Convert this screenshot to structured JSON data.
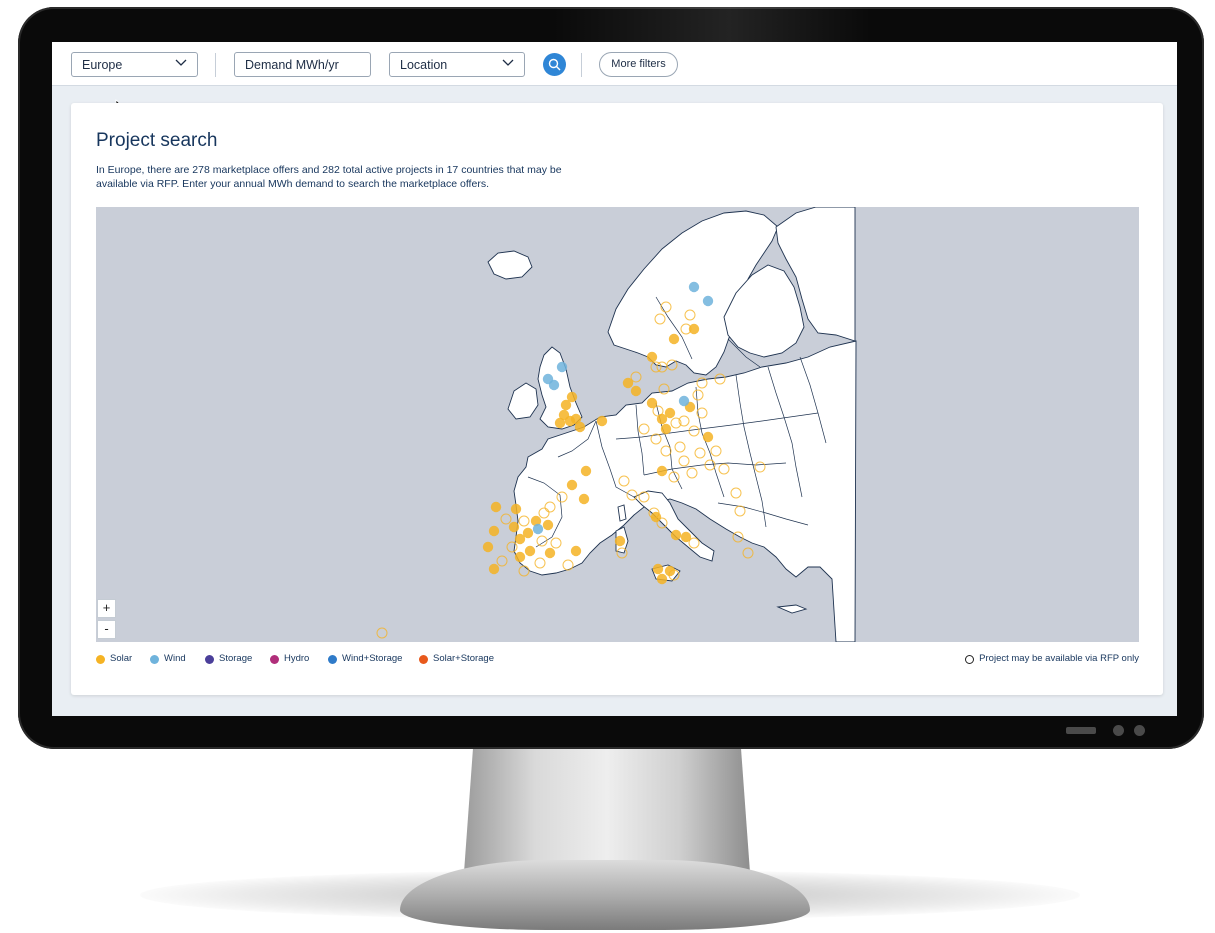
{
  "toolbar": {
    "region_select": "Europe",
    "demand_input_placeholder": "Demand MWh/yr",
    "location_select": "Location",
    "search_icon": "search-icon",
    "more_filters_label": "More filters"
  },
  "card": {
    "title": "Project search",
    "description": "In Europe, there are 278 marketplace offers and 282 total active projects in 17 countries that may be available via RFP. Enter your annual MWh demand to search the marketplace offers."
  },
  "map": {
    "zoom_in": "+",
    "zoom_out": "-",
    "colors": {
      "solar": "#f5b324",
      "wind": "#6fb3dc",
      "storage": "#4b3f9a",
      "hydro": "#b02e7a",
      "wind_storage": "#2f7bc9",
      "solar_storage": "#e8591c",
      "sea": "#c9ced8",
      "land": "#ffffff",
      "border": "#1f3350"
    }
  },
  "legend": {
    "items": [
      {
        "label": "Solar",
        "color": "#f5b324"
      },
      {
        "label": "Wind",
        "color": "#6fb3dc"
      },
      {
        "label": "Storage",
        "color": "#4b3f9a"
      },
      {
        "label": "Hydro",
        "color": "#b02e7a"
      },
      {
        "label": "Wind+Storage",
        "color": "#2f7bc9"
      },
      {
        "label": "Solar+Storage",
        "color": "#e8591c"
      }
    ],
    "rfp_note": "Project may be available via RFP only"
  }
}
